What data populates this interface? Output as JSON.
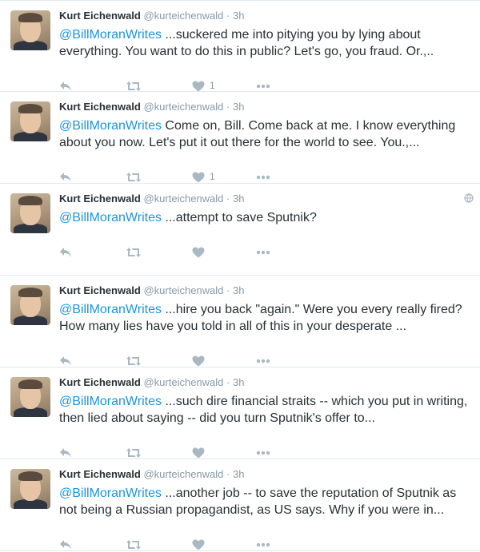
{
  "colors": {
    "name": "#292f33",
    "muted": "#8899a6",
    "link": "#1b95e0",
    "icon": "#aab8c2",
    "divider": "#e1e8ed"
  },
  "icons": {
    "reply": "reply-icon",
    "retweet": "retweet-icon",
    "like": "heart-icon",
    "more": "more-icon",
    "globe": "globe-icon"
  },
  "tweets": [
    {
      "name": "Kurt Eichenwald",
      "handle": "@kurteichenwald",
      "dot": "·",
      "time": "3h",
      "mention": "@BillMoranWrites",
      "body": " ...suckered me into pitying you by lying about everything. You want to do this in public? Let's go, you fraud. Or.,..",
      "likes": "1"
    },
    {
      "name": "Kurt Eichenwald",
      "handle": "@kurteichenwald",
      "dot": "·",
      "time": "3h",
      "mention": "@BillMoranWrites",
      "body": " Come on, Bill. Come back at me. I know everything about you now. Let's put it out there for the world to see. You.,...",
      "likes": "1"
    },
    {
      "name": "Kurt Eichenwald",
      "handle": "@kurteichenwald",
      "dot": "·",
      "time": "3h",
      "mention": "@BillMoranWrites",
      "body": " ...attempt to save Sputnik?",
      "likes": ""
    },
    {
      "name": "Kurt Eichenwald",
      "handle": "@kurteichenwald",
      "dot": "·",
      "time": "3h",
      "mention": "@BillMoranWrites",
      "body": " ...hire you back \"again.\" Were you every really fired? How many lies have you told in all of this in your desperate ...",
      "likes": ""
    },
    {
      "name": "Kurt Eichenwald",
      "handle": "@kurteichenwald",
      "dot": "·",
      "time": "3h",
      "mention": "@BillMoranWrites",
      "body": " ...such dire financial straits -- which you put in writing, then lied about saying -- did you turn Sputnik's offer to...",
      "likes": ""
    },
    {
      "name": "Kurt Eichenwald",
      "handle": "@kurteichenwald",
      "dot": "·",
      "time": "3h",
      "mention": "@BillMoranWrites",
      "body": " ...another job -- to save the reputation of Sputnik as not being a Russian propagandist, as US says. Why if you were in...",
      "likes": ""
    }
  ]
}
